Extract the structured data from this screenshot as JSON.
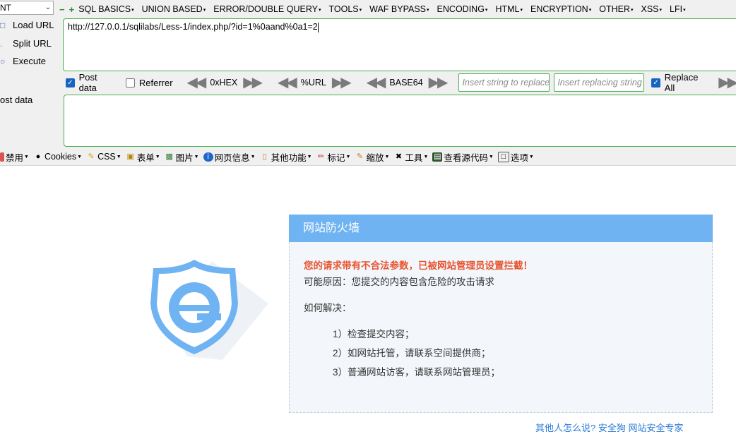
{
  "hackbar": {
    "select_value": "NT",
    "menu": [
      "SQL BASICS",
      "UNION BASED",
      "ERROR/DOUBLE QUERY",
      "TOOLS",
      "WAF BYPASS",
      "ENCODING",
      "HTML",
      "ENCRYPTION",
      "OTHER",
      "XSS",
      "LFI"
    ],
    "load_url": "Load URL",
    "split_url": "Split URL",
    "execute": "Execute",
    "url_value": "http://127.0.0.1/sqlilabs/Less-1/index.php/?id=1%0aand%0a1=2",
    "post_data_label": "Post data",
    "referrer_label": "Referrer",
    "hex_label": "0xHEX",
    "url_enc_label": "%URL",
    "base64_label": "BASE64",
    "replace_placeholder": "Insert string to replace",
    "replacing_placeholder": "Insert replacing string",
    "replace_all_label": "Replace All",
    "post_data_area_label": "ost data"
  },
  "webdev": {
    "items": [
      "禁用",
      "Cookies",
      "CSS",
      "表单",
      "图片",
      "网页信息",
      "其他功能",
      "标记",
      "缩放",
      "工具",
      "查看源代码",
      "选项"
    ]
  },
  "waf": {
    "title": "网站防火墙",
    "warning": "您的请求带有不合法参数，已被网站管理员设置拦截！",
    "reason": "可能原因：您提交的内容包含危险的攻击请求",
    "how": "如何解决：",
    "steps": [
      "1）检查提交内容；",
      "2）如网站托管，请联系空间提供商；",
      "3）普通网站访客，请联系网站管理员；"
    ],
    "footer": "其他人怎么说?      安全狗 网站安全专家"
  }
}
